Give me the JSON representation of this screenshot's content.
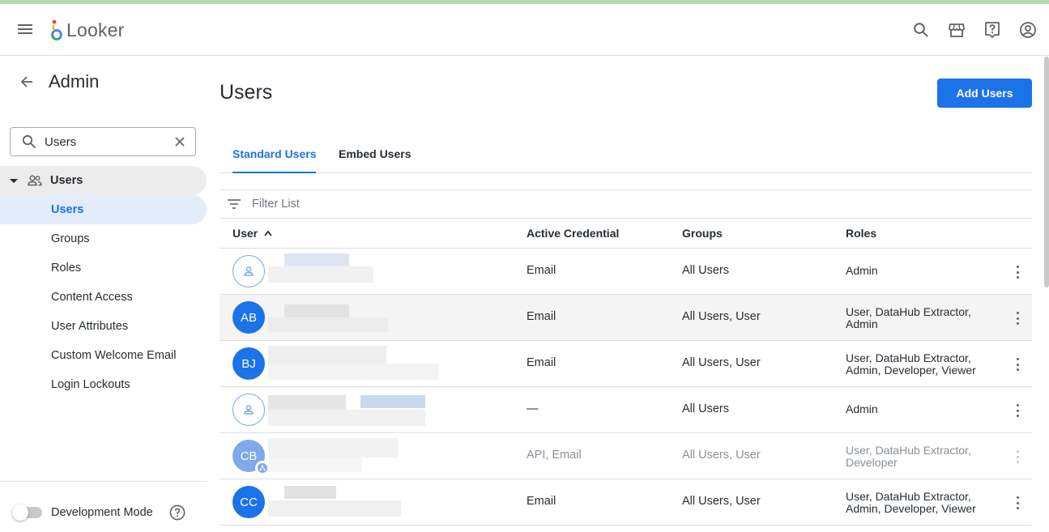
{
  "app": {
    "name": "Looker"
  },
  "topbar": {
    "icons": [
      "search-icon",
      "marketplace-icon",
      "help-icon",
      "account-icon"
    ]
  },
  "sidebar": {
    "title": "Admin",
    "search": {
      "value": "Users"
    },
    "group": {
      "label": "Users"
    },
    "items": [
      {
        "label": "Users",
        "active": true
      },
      {
        "label": "Groups"
      },
      {
        "label": "Roles"
      },
      {
        "label": "Content Access"
      },
      {
        "label": "User Attributes"
      },
      {
        "label": "Custom Welcome Email"
      },
      {
        "label": "Login Lockouts"
      }
    ],
    "dev_mode": {
      "label": "Development Mode",
      "enabled": false
    }
  },
  "main": {
    "title": "Users",
    "add_button": "Add Users",
    "tabs": [
      {
        "label": "Standard Users",
        "active": true
      },
      {
        "label": "Embed Users"
      }
    ],
    "filter": {
      "placeholder": "Filter List"
    },
    "columns": [
      "User",
      "Active Credential",
      "Groups",
      "Roles"
    ],
    "rows": [
      {
        "avatar": "",
        "credential": "Email",
        "groups": "All Users",
        "roles_line1": "Admin",
        "roles_line2": ""
      },
      {
        "avatar": "AB",
        "credential": "Email",
        "groups": "All Users, User",
        "roles_line1": "User, DataHub Extractor,",
        "roles_line2": "Admin"
      },
      {
        "avatar": "BJ",
        "credential": "Email",
        "groups": "All Users, User",
        "roles_line1": "User, DataHub Extractor,",
        "roles_line2": "Admin, Developer, Viewer"
      },
      {
        "avatar": "",
        "credential": "—",
        "groups": "All Users",
        "roles_line1": "Admin",
        "roles_line2": ""
      },
      {
        "avatar": "CB",
        "credential": "API, Email",
        "groups": "All Users, User",
        "roles_line1": "User, DataHub Extractor,",
        "roles_line2": "Developer"
      },
      {
        "avatar": "CC",
        "credential": "Email",
        "groups": "All Users, User",
        "roles_line1": "User, DataHub Extractor,",
        "roles_line2": "Admin, Developer, Viewer"
      }
    ]
  },
  "colors": {
    "accent": "#1a73e8",
    "avatar_light": "#7ea9ea",
    "text": "#262d33",
    "muted": "#707781"
  }
}
